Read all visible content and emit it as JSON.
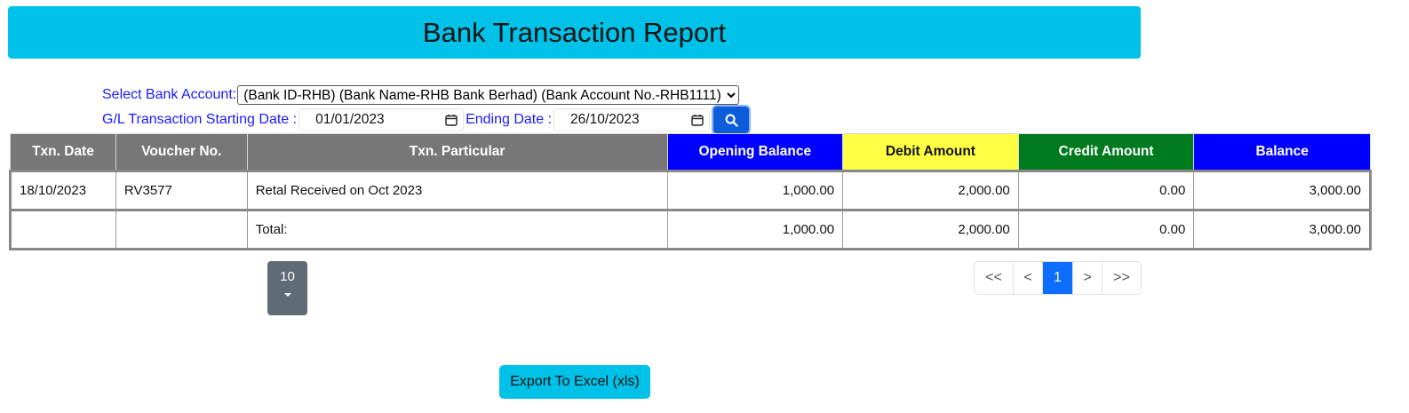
{
  "header": {
    "title": "Bank Transaction Report"
  },
  "filters": {
    "bank_account_label": "Select Bank Account:",
    "bank_account_value": "(Bank ID-RHB) (Bank Name-RHB Bank Berhad) (Bank Account No.-RHB1111)",
    "start_date_label": "G/L Transaction Starting Date :",
    "start_date_value": "01/01/2023",
    "end_date_label": "Ending Date :",
    "end_date_value": "26/10/2023",
    "search_icon": "search-icon"
  },
  "table": {
    "headers": [
      "Txn. Date",
      "Voucher No.",
      "Txn. Particular",
      "Opening Balance",
      "Debit Amount",
      "Credit Amount",
      "Balance"
    ],
    "header_colors": {
      "default": "#777777",
      "opening_balance": "#0000ff",
      "debit_amount": "#ffff44",
      "credit_amount": "#007a1f",
      "balance": "#0000ff"
    },
    "rows": [
      {
        "date": "18/10/2023",
        "voucher": "RV3577",
        "particular": "Retal Received on Oct 2023",
        "opening": "1,000.00",
        "debit": "2,000.00",
        "credit": "0.00",
        "balance": "3,000.00"
      }
    ],
    "total": {
      "label": "Total:",
      "opening": "1,000.00",
      "debit": "2,000.00",
      "credit": "0.00",
      "balance": "3,000.00"
    }
  },
  "pagination": {
    "page_size": "10",
    "first": "<<",
    "prev": "<",
    "current": "1",
    "next": ">",
    "last": ">>"
  },
  "actions": {
    "export_label": "Export To Excel (xls)"
  }
}
